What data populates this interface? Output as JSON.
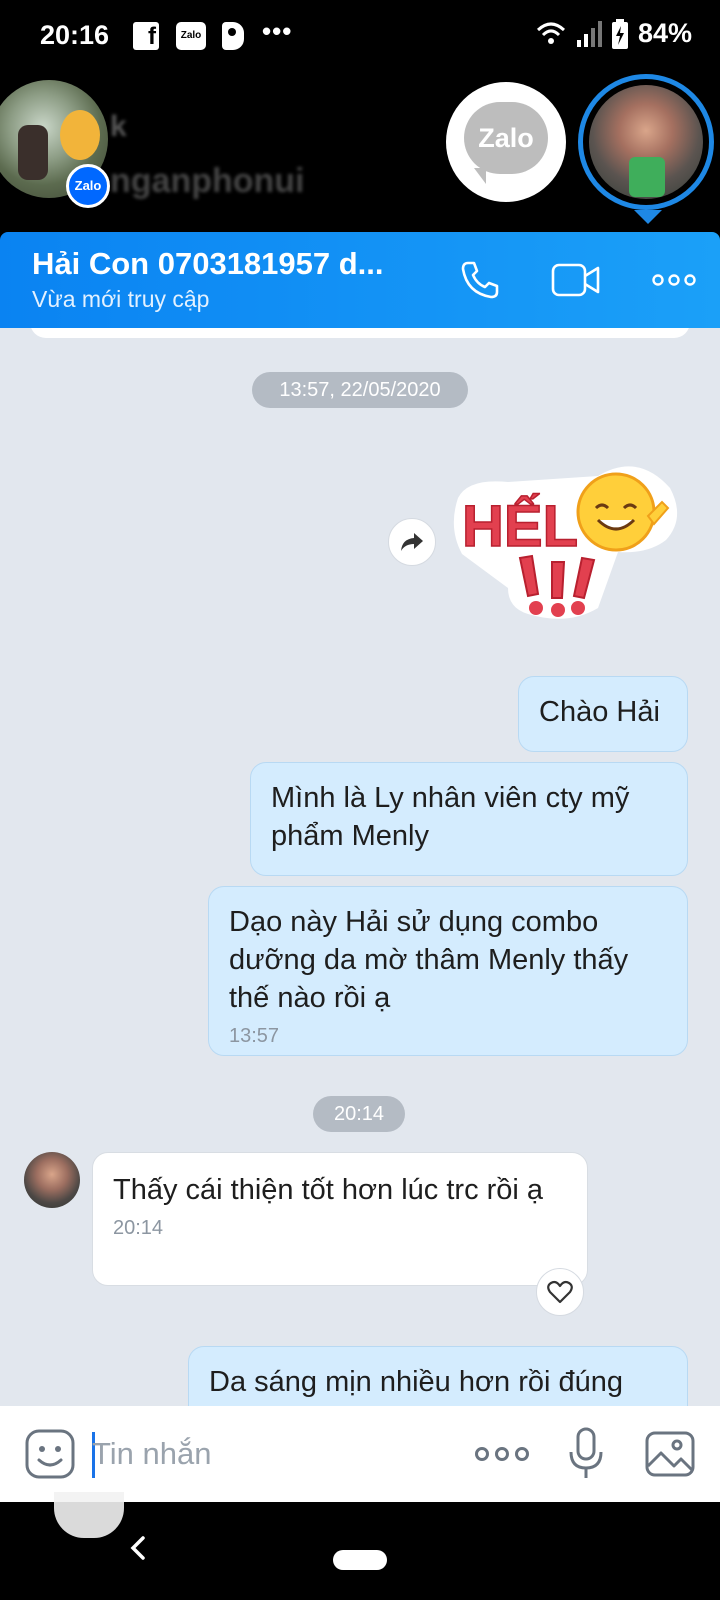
{
  "status_bar": {
    "time": "20:16",
    "notification_icons": [
      "facebook-icon",
      "zalo-icon",
      "p-icon"
    ],
    "more": "•••",
    "battery": "84%"
  },
  "chat_heads": {
    "blurred_line1": "k",
    "blurred_line2": "nganphonui",
    "zalo_badge": "Zalo",
    "zalo_head_label": "Zalo"
  },
  "header": {
    "contact_name": "Hải Con   0703181957 d...",
    "status": "Vừa mới truy cập"
  },
  "messages": {
    "time_divider_1": "13:57, 22/05/2020",
    "time_divider_2": "20:14",
    "outgoing": [
      {
        "text": "Chào Hải"
      },
      {
        "text": "Mình là Ly nhân viên cty mỹ phẩm Menly"
      },
      {
        "text": "Dạo này Hải sử dụng combo dưỡng da mờ thâm Menly thấy thế nào rồi ạ",
        "time": "13:57"
      },
      {
        "text": "Da sáng mịn nhiều hơn rồi đúng"
      }
    ],
    "incoming": [
      {
        "text": "Thấy cái thiện tốt hơn lúc trc rồi ạ",
        "time": "20:14"
      }
    ],
    "sticker_text": "HẾLLO!!!"
  },
  "input": {
    "placeholder": "Tin nhắn"
  },
  "colors": {
    "header_start": "#0a83f2",
    "header_end": "#1ba0f8",
    "outgoing_bubble": "#d4ecfe",
    "chat_bg": "#e2e7ee"
  }
}
